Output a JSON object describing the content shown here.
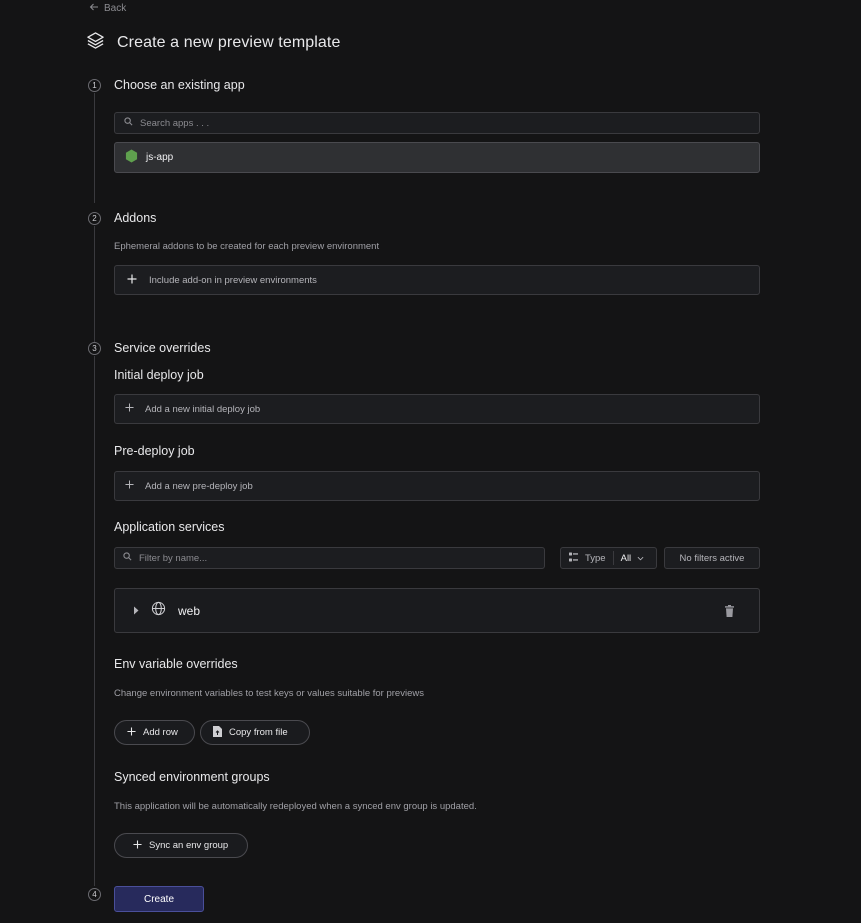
{
  "header": {
    "back_label": "Back",
    "title": "Create a new preview template",
    "title_icon": "layers-icon"
  },
  "steps": {
    "step1": {
      "number": "1",
      "title": "Choose an existing app",
      "search_placeholder": "Search apps . . .",
      "app_name": "js-app",
      "app_icon": "nodejs-icon"
    },
    "step2": {
      "number": "2",
      "title": "Addons",
      "description": "Ephemeral addons to be created for each preview environment",
      "add_label": "Include add-on in preview environments"
    },
    "step3": {
      "number": "3",
      "title": "Service overrides",
      "initial_deploy": {
        "heading": "Initial deploy job",
        "add_label": "Add a new initial deploy job"
      },
      "pre_deploy": {
        "heading": "Pre-deploy job",
        "add_label": "Add a new pre-deploy job"
      },
      "app_services": {
        "heading": "Application services",
        "filter_placeholder": "Filter by name...",
        "type_label": "Type",
        "type_value": "All",
        "filters_status": "No filters active",
        "services": [
          {
            "name": "web",
            "icon": "globe-icon"
          }
        ]
      },
      "env_overrides": {
        "heading": "Env variable overrides",
        "description": "Change environment variables to test keys or values suitable for previews",
        "add_row_label": "Add row",
        "copy_file_label": "Copy from file"
      },
      "synced_groups": {
        "heading": "Synced environment groups",
        "description": "This application will be automatically redeployed when a synced env group is updated.",
        "sync_label": "Sync an env group"
      }
    },
    "step4": {
      "number": "4",
      "create_label": "Create"
    }
  },
  "colors": {
    "background": "#141415",
    "primary_button": "#272a5c",
    "node_green": "#5fa04e"
  }
}
